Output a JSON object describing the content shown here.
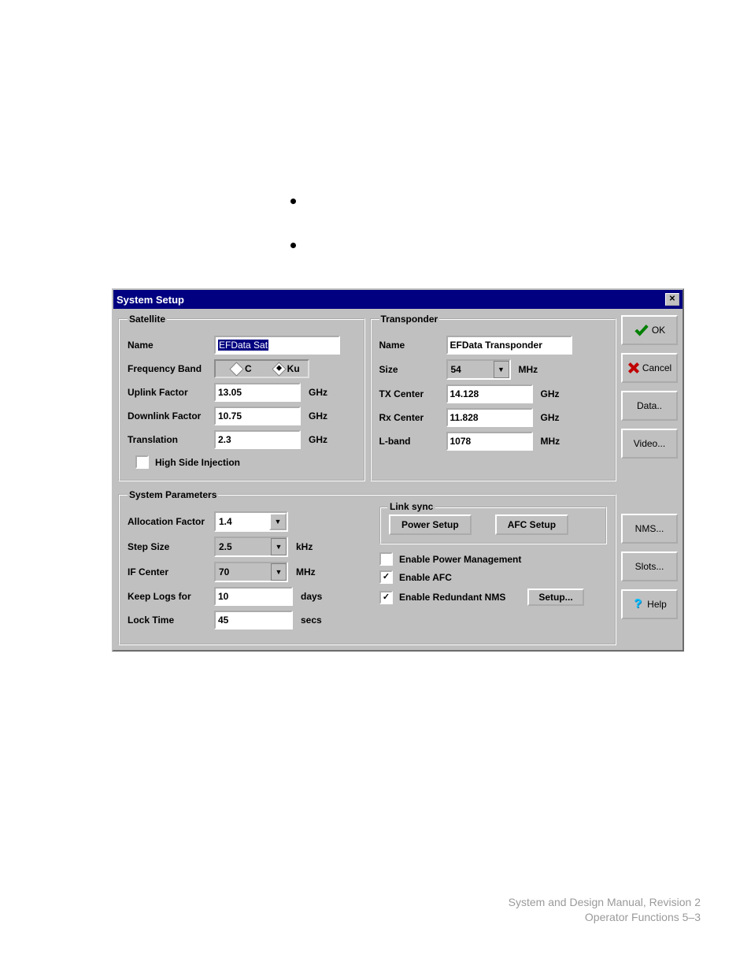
{
  "title": "System Setup",
  "satellite": {
    "legend": "Satellite",
    "name_label": "Name",
    "name_value": "EFData Sat",
    "freqband_label": "Frequency Band",
    "band_c": "C",
    "band_ku": "Ku",
    "uplink_label": "Uplink Factor",
    "uplink_value": "13.05",
    "downlink_label": "Downlink Factor",
    "downlink_value": "10.75",
    "translation_label": "Translation",
    "translation_value": "2.3",
    "ghz": "GHz",
    "highside_label": "High Side Injection"
  },
  "transponder": {
    "legend": "Transponder",
    "name_label": "Name",
    "name_value": "EFData Transponder",
    "size_label": "Size",
    "size_value": "54",
    "mhz": "MHz",
    "tx_label": "TX Center",
    "tx_value": "14.128",
    "rx_label": "Rx Center",
    "rx_value": "11.828",
    "lband_label": "L-band",
    "lband_value": "1078",
    "ghz": "GHz"
  },
  "sysparams": {
    "legend": "System Parameters",
    "alloc_label": "Allocation Factor",
    "alloc_value": "1.4",
    "step_label": "Step Size",
    "step_value": "2.5",
    "khz": "kHz",
    "if_label": "IF Center",
    "if_value": "70",
    "mhz": "MHz",
    "logs_label": "Keep Logs for",
    "logs_value": "10",
    "days": "days",
    "lock_label": "Lock Time",
    "lock_value": "45",
    "secs": "secs",
    "linksync_legend": "Link sync",
    "power_setup": "Power Setup",
    "afc_setup": "AFC Setup",
    "enable_power": "Enable Power Management",
    "enable_afc": "Enable AFC",
    "enable_redundant": "Enable Redundant NMS",
    "setup": "Setup..."
  },
  "buttons": {
    "ok": "OK",
    "cancel": "Cancel",
    "data": "Data..",
    "video": "Video...",
    "nms": "NMS...",
    "slots": "Slots...",
    "help": "Help"
  },
  "footer": {
    "line1": "System and Design Manual, Revision 2",
    "line2": "Operator Functions  5–3"
  }
}
